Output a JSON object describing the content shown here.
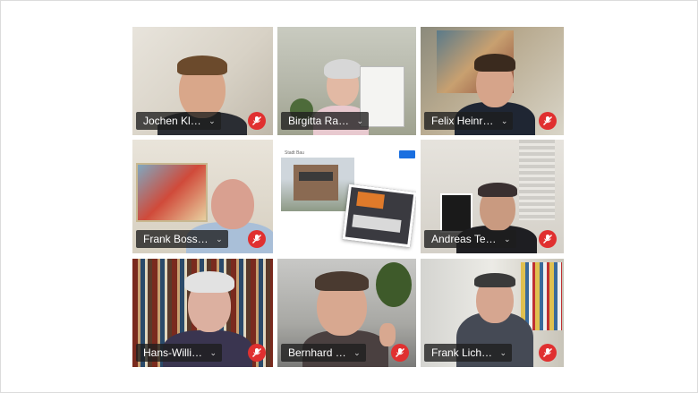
{
  "meeting": {
    "tiles": [
      {
        "name": "Jochen Kl…"
      },
      {
        "name": "Birgitta Ra…"
      },
      {
        "name": "Felix Heinr…"
      },
      {
        "name": "Frank Boss…"
      },
      {
        "name": ""
      },
      {
        "name": "Andreas Te…"
      },
      {
        "name": "Hans-Willi…"
      },
      {
        "name": "Bernhard …"
      },
      {
        "name": "Frank Lich…"
      }
    ],
    "shared_screen": {
      "header_text": "Stadt Bau"
    }
  },
  "colors": {
    "active_border": "#1a5fd6",
    "mute_red": "#e03030",
    "name_bg": "#1e1e1e"
  }
}
